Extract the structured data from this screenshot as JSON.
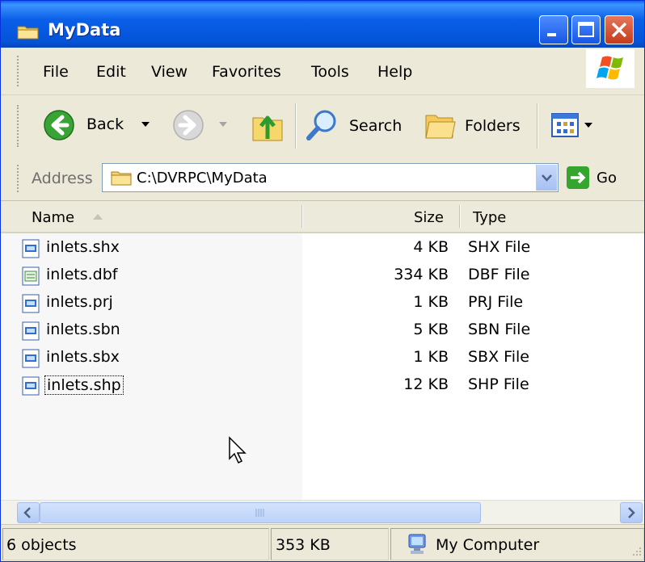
{
  "window": {
    "title": "MyData"
  },
  "menu": [
    "File",
    "Edit",
    "View",
    "Favorites",
    "Tools",
    "Help"
  ],
  "toolbar": {
    "back_label": "Back",
    "search_label": "Search",
    "folders_label": "Folders"
  },
  "address": {
    "label": "Address",
    "path": "C:\\DVRPC\\MyData",
    "go_label": "Go"
  },
  "columns": {
    "name": "Name",
    "size": "Size",
    "type": "Type",
    "sorted_by": "Name"
  },
  "files": [
    {
      "name": "inlets.shx",
      "size": "4 KB",
      "type": "SHX File",
      "icon": "file-shx-icon"
    },
    {
      "name": "inlets.dbf",
      "size": "334 KB",
      "type": "DBF File",
      "icon": "file-dbf-icon"
    },
    {
      "name": "inlets.prj",
      "size": "1 KB",
      "type": "PRJ File",
      "icon": "file-prj-icon"
    },
    {
      "name": "inlets.sbn",
      "size": "5 KB",
      "type": "SBN File",
      "icon": "file-sbn-icon"
    },
    {
      "name": "inlets.sbx",
      "size": "1 KB",
      "type": "SBX File",
      "icon": "file-sbx-icon"
    },
    {
      "name": "inlets.shp",
      "size": "12 KB",
      "type": "SHP File",
      "icon": "file-shp-icon"
    }
  ],
  "status": {
    "objects": "6 objects",
    "total_size": "353 KB",
    "location": "My Computer"
  },
  "colors": {
    "titlebar": "#0a5fe8",
    "window_bg": "#ece9d8",
    "close_button": "#c43b1b"
  }
}
